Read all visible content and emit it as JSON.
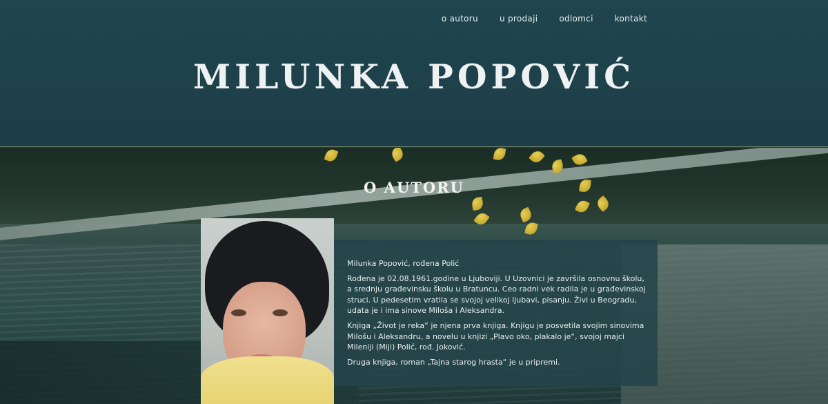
{
  "nav": {
    "items": [
      "o autoru",
      "u prodaji",
      "odlomci",
      "kontakt"
    ]
  },
  "site": {
    "title": "MILUNKA POPOVIĆ"
  },
  "about": {
    "heading": "O AUTORU",
    "paragraphs": [
      "Milunka Popović, rođena Polić",
      "Rođena je 02.08.1961.godine u Ljuboviji. U Uzovnici je završila osnovnu školu, a srednju građevinsku školu u Bratuncu. Ceo radni vek radila je u građevinskoj struci. U pedesetim vratila se svojoj velikoj ljubavi, pisanju. Živi u Beogradu, udata je i ima sinove Miloša i Aleksandra.",
      "Knjiga „Život je reka“ je njena prva knjiga. Knjigu je posvetila svojim sinovima Milošu i Aleksandru, a novelu u knjizi „Plavo oko, plakalo je“, svojoj majci Mileniji (Miji) Polić, rođ. Joković.",
      "Druga knjiga, roman „Tajna starog hrasta“ je u pripremi."
    ]
  },
  "colors": {
    "header": "#1f454e",
    "bio_panel": "#24444a",
    "text": "#e8eeee"
  }
}
